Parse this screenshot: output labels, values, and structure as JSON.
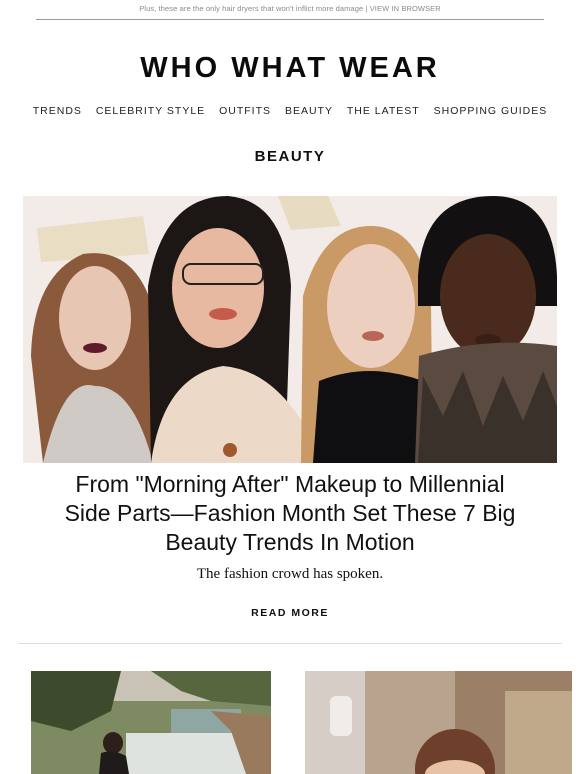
{
  "preheader": {
    "text": "Plus, these are the only hair dryers that won't inflict more damage | ",
    "link": "VIEW IN BROWSER"
  },
  "brand": {
    "logo_text": "WHO WHAT WEAR"
  },
  "nav": {
    "items": [
      "TRENDS",
      "CELEBRITY STYLE",
      "OUTFITS",
      "BEAUTY",
      "THE LATEST",
      "SHOPPING GUIDES"
    ]
  },
  "section": {
    "title": "BEAUTY"
  },
  "feature": {
    "headline": "From \"Morning After\" Makeup to Millennial Side Parts—Fashion Month Set These 7 Big Beauty Trends In Motion",
    "dek": "The fashion crowd has spoken.",
    "cta": "READ MORE"
  },
  "colors": {
    "hero_bg": "#f2ebe7",
    "text": "#111111",
    "preheader": "#8a8a8a"
  }
}
